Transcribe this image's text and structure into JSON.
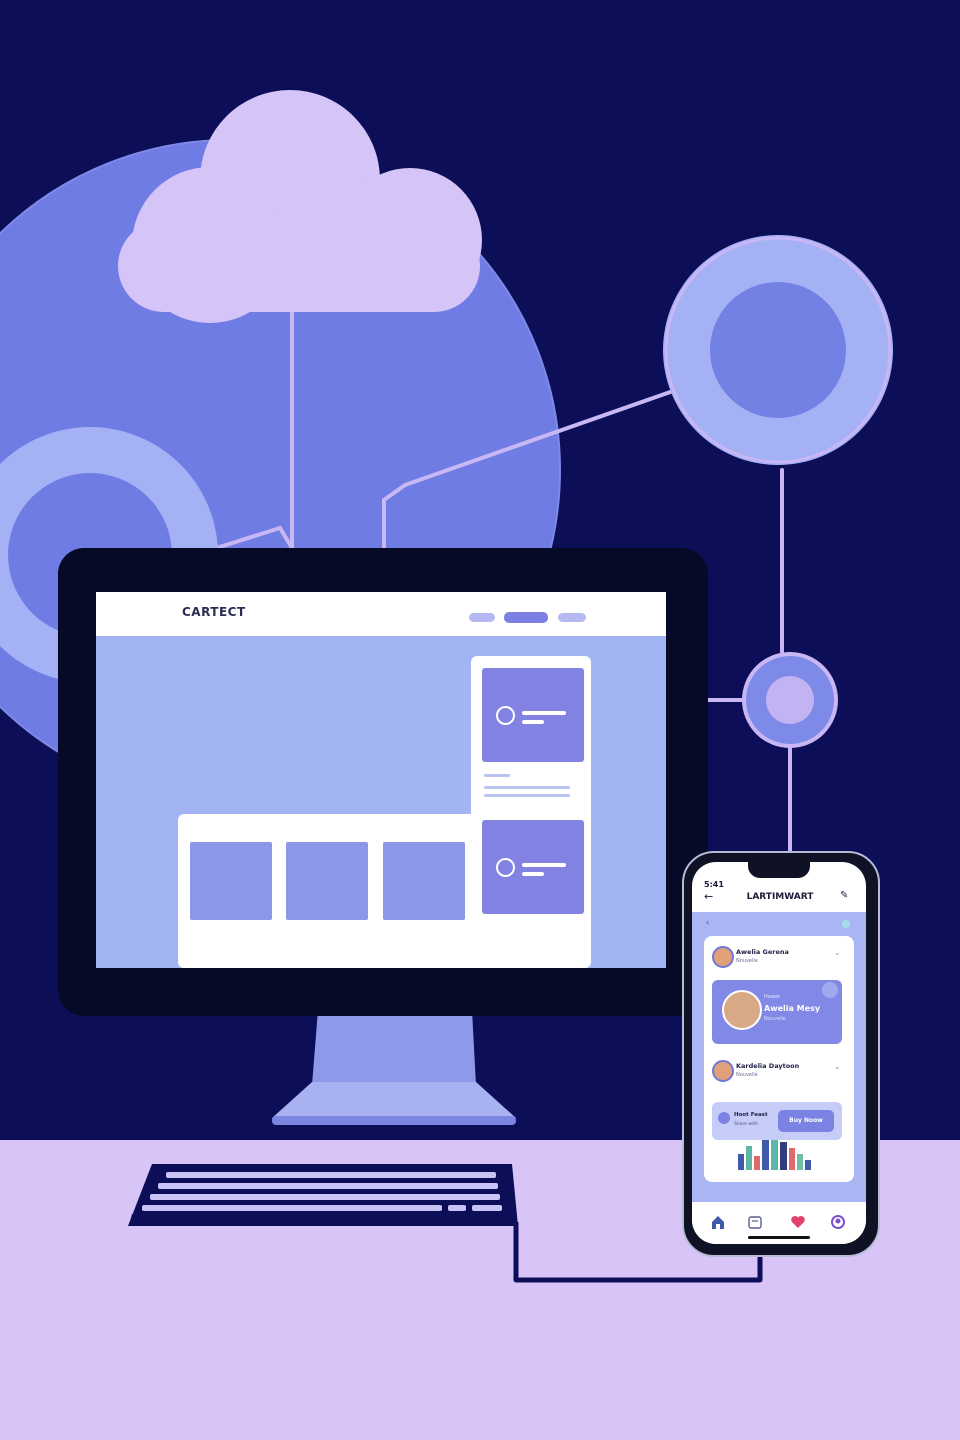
{
  "colors": {
    "background_dark": "#0c0f58",
    "globe": "#6f7ce3",
    "cloud": "#d5c4f7",
    "node_outer": "#a5b1f5",
    "node_inner": "#7281e3",
    "line": "#c9b6f5",
    "desk": "#d9c4f8",
    "accent": "#7c80e3"
  },
  "website": {
    "logo": "CARTECT",
    "nav_items": [
      "",
      "",
      ""
    ]
  },
  "phone": {
    "status_time": "5:41",
    "app_title": "LARTIMWART",
    "contacts": [
      {
        "name": "Awelia Gerena",
        "sub": "Nouvelle"
      },
      {
        "name": "Kardelia Daytoon",
        "sub": "Nouvelle"
      }
    ],
    "featured": {
      "label": "Hawat",
      "name": "Awelia Mesy",
      "sub": "Nouvelle"
    },
    "cta": {
      "title": "Hoot Feast",
      "sub": "Share with",
      "button": "Buy Noow"
    },
    "tabs": [
      "home-icon",
      "calendar-icon",
      "heart-icon",
      "profile-icon"
    ]
  }
}
